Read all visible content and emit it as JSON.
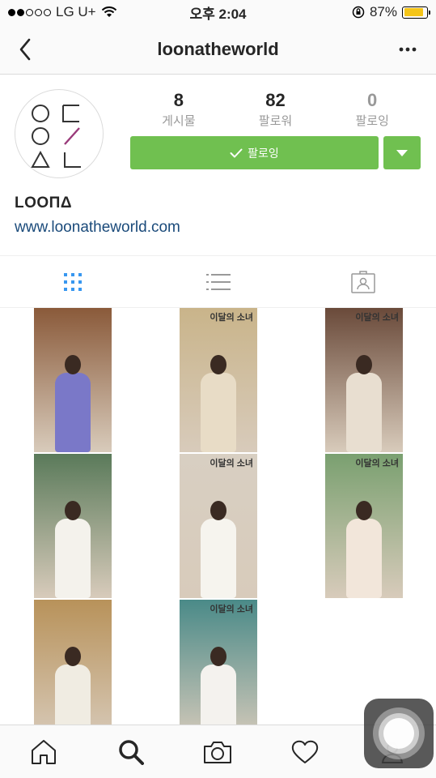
{
  "status_bar": {
    "carrier": "LG U+",
    "time": "오후 2:04",
    "battery_percent": "87%",
    "battery_level": 0.87,
    "signal_bars": 2
  },
  "header": {
    "title": "loonatheworld",
    "back_icon": "chevron-left-icon",
    "more_icon": "ellipsis-icon"
  },
  "profile": {
    "stats": [
      {
        "value": "8",
        "label": "게시물"
      },
      {
        "value": "82",
        "label": "팔로워"
      },
      {
        "value": "0",
        "label": "팔로잉"
      }
    ],
    "follow_button_label": "팔로잉",
    "name": "LOOΠΔ",
    "website": "www.loonatheworld.com"
  },
  "view_tabs": [
    {
      "icon": "grid-icon",
      "active": true
    },
    {
      "icon": "list-icon",
      "active": false
    },
    {
      "icon": "tagged-icon",
      "active": false
    }
  ],
  "posts": [
    {
      "tag": "",
      "background": "#8a5a3a",
      "dress": "#7a78c8"
    },
    {
      "tag": "이달의 소녀",
      "background": "#c9b48a",
      "dress": "#e8dcc6"
    },
    {
      "tag": "이달의 소녀",
      "background": "#6a4a3a",
      "dress": "#e8ded0"
    },
    {
      "tag": "",
      "background": "#5a7a5a",
      "dress": "#f4f2ec"
    },
    {
      "tag": "이달의 소녀",
      "background": "#d8cfc2",
      "dress": "#f6f4ee"
    },
    {
      "tag": "이달의 소녀",
      "background": "#7aa070",
      "dress": "#f2e6da"
    },
    {
      "tag": "",
      "background": "#b8925a",
      "dress": "#f0ece2"
    },
    {
      "tag": "이달의 소녀",
      "background": "#4a8a88",
      "dress": "#f4f2ee"
    }
  ],
  "bottom_nav": [
    {
      "icon": "home-icon",
      "active": false
    },
    {
      "icon": "search-icon",
      "active": true
    },
    {
      "icon": "camera-icon",
      "active": false
    },
    {
      "icon": "heart-icon",
      "active": false
    },
    {
      "icon": "profile-icon",
      "active": false
    }
  ],
  "colors": {
    "follow_green": "#70c050",
    "link_blue": "#1a4a7a",
    "active_tab_blue": "#3897f0"
  }
}
